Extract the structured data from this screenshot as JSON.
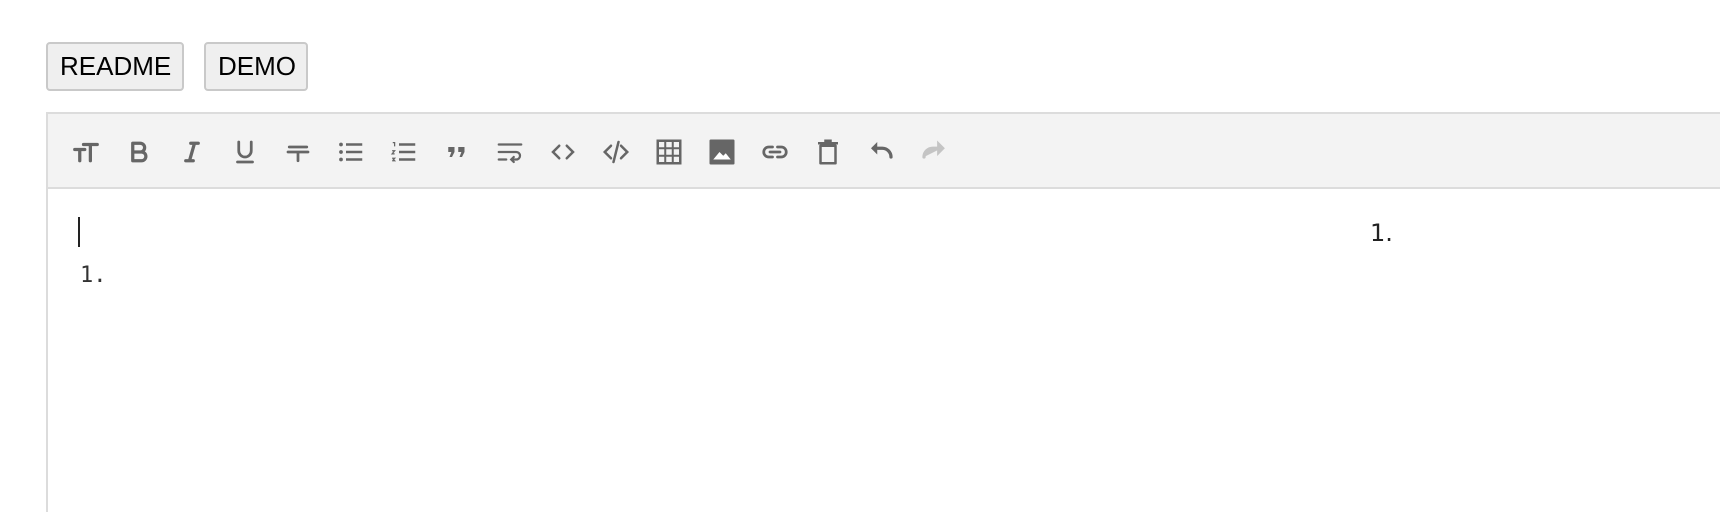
{
  "buttons": {
    "readme": "README",
    "demo": "DEMO"
  },
  "toolbar": {
    "icons": [
      "text-size-icon",
      "bold-icon",
      "italic-icon",
      "underline-icon",
      "strikethrough-icon",
      "bullet-list-icon",
      "numbered-list-icon",
      "blockquote-icon",
      "wrap-icon",
      "inline-code-icon",
      "code-block-icon",
      "table-icon",
      "image-icon",
      "link-icon",
      "clear-icon",
      "undo-icon",
      "redo-icon"
    ],
    "icon_color": "#666666",
    "disabled_color": "#c4c4c4"
  },
  "editor": {
    "markdown_line": "1."
  },
  "preview": {
    "list_marker": "1."
  }
}
